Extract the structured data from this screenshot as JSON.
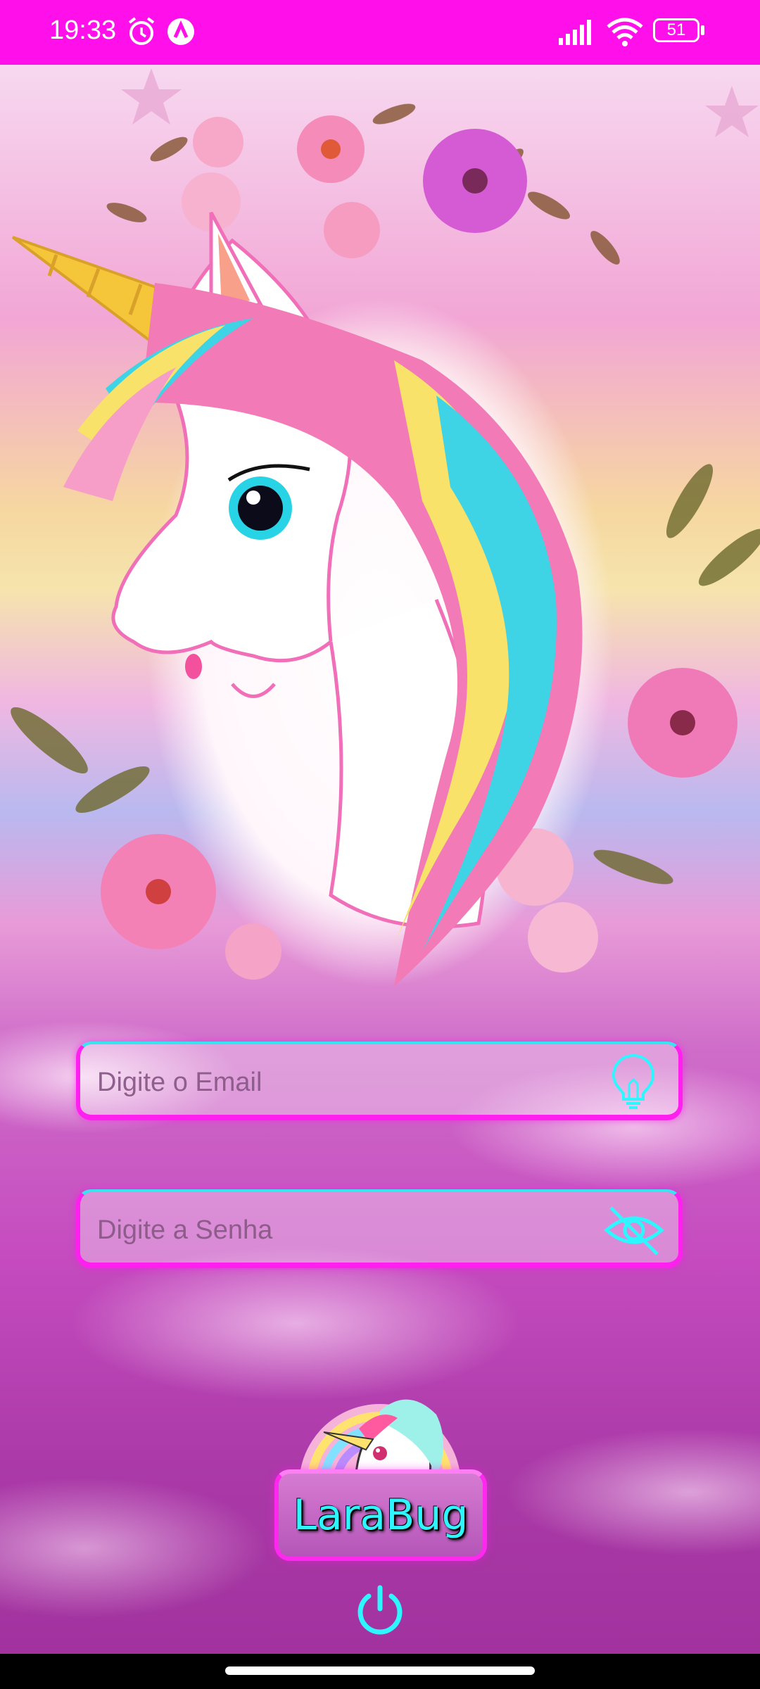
{
  "status_bar": {
    "time": "19:33",
    "battery": "51",
    "icons": [
      "alarm-icon",
      "app-notification-icon",
      "signal-icon",
      "wifi-icon",
      "battery-icon"
    ]
  },
  "login": {
    "email": {
      "placeholder": "Digite o Email",
      "value": "",
      "icon": "lightbulb-icon"
    },
    "password": {
      "placeholder": "Digite a Senha",
      "value": "",
      "icon": "eye-off-icon"
    }
  },
  "brand": {
    "label": "LaraBug"
  },
  "power": {
    "icon": "power-icon"
  },
  "colors": {
    "accent": "#ff10ea",
    "cyan": "#2ef6ff"
  }
}
